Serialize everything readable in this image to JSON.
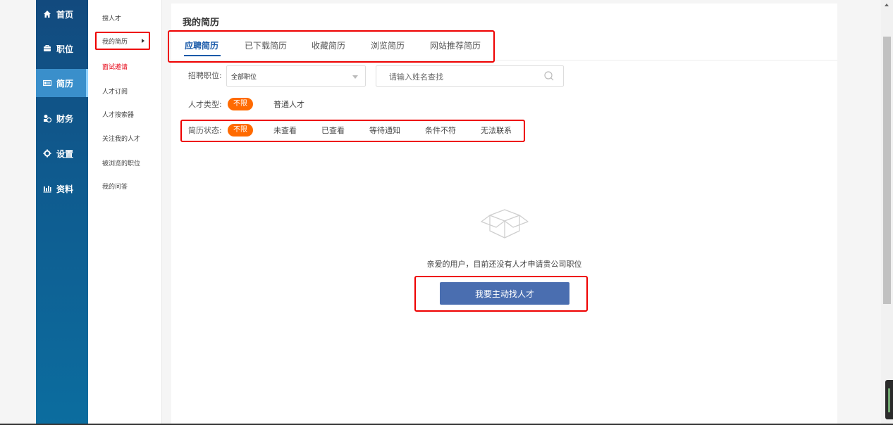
{
  "sidebar": {
    "items": [
      {
        "label": "首页",
        "icon": "home-icon"
      },
      {
        "label": "职位",
        "icon": "briefcase-icon"
      },
      {
        "label": "简历",
        "icon": "id-card-icon"
      },
      {
        "label": "财务",
        "icon": "finance-icon"
      },
      {
        "label": "设置",
        "icon": "gear-icon"
      },
      {
        "label": "资料",
        "icon": "chart-bars-icon"
      }
    ],
    "active_index": 2
  },
  "submenu": {
    "items": [
      {
        "label": "搜人才"
      },
      {
        "label": "我的简历"
      },
      {
        "label": "面试邀请"
      },
      {
        "label": "人才订阅"
      },
      {
        "label": "人才搜索器"
      },
      {
        "label": "关注我的人才"
      },
      {
        "label": "被浏览的职位"
      },
      {
        "label": "我的问答"
      }
    ],
    "current_index": 1
  },
  "main": {
    "title": "我的简历",
    "tabs": [
      {
        "label": "应聘简历"
      },
      {
        "label": "已下载简历"
      },
      {
        "label": "收藏简历"
      },
      {
        "label": "浏览简历"
      },
      {
        "label": "网站推荐简历"
      }
    ],
    "active_tab_index": 0,
    "filters": {
      "position_label": "招聘职位:",
      "position_value": "全部职位",
      "search_placeholder": "请输入姓名查找",
      "talent_type_label": "人才类型:",
      "talent_type_options": [
        "不限",
        "普通人才"
      ],
      "status_label": "简历状态:",
      "status_options": [
        "不限",
        "未查看",
        "已查看",
        "等待通知",
        "条件不符",
        "无法联系"
      ]
    },
    "empty": {
      "icon": "empty-box-icon",
      "message": "亲爱的用户，目前还没有人才申请贵公司职位",
      "button_label": "我要主动找人才"
    }
  },
  "colors": {
    "accent_blue": "#1a5aa9",
    "pill_orange": "#ff6a00",
    "button_blue": "#4a6eb0",
    "highlight_red": "#ee0000",
    "sidebar_dark": "#124a7e"
  }
}
